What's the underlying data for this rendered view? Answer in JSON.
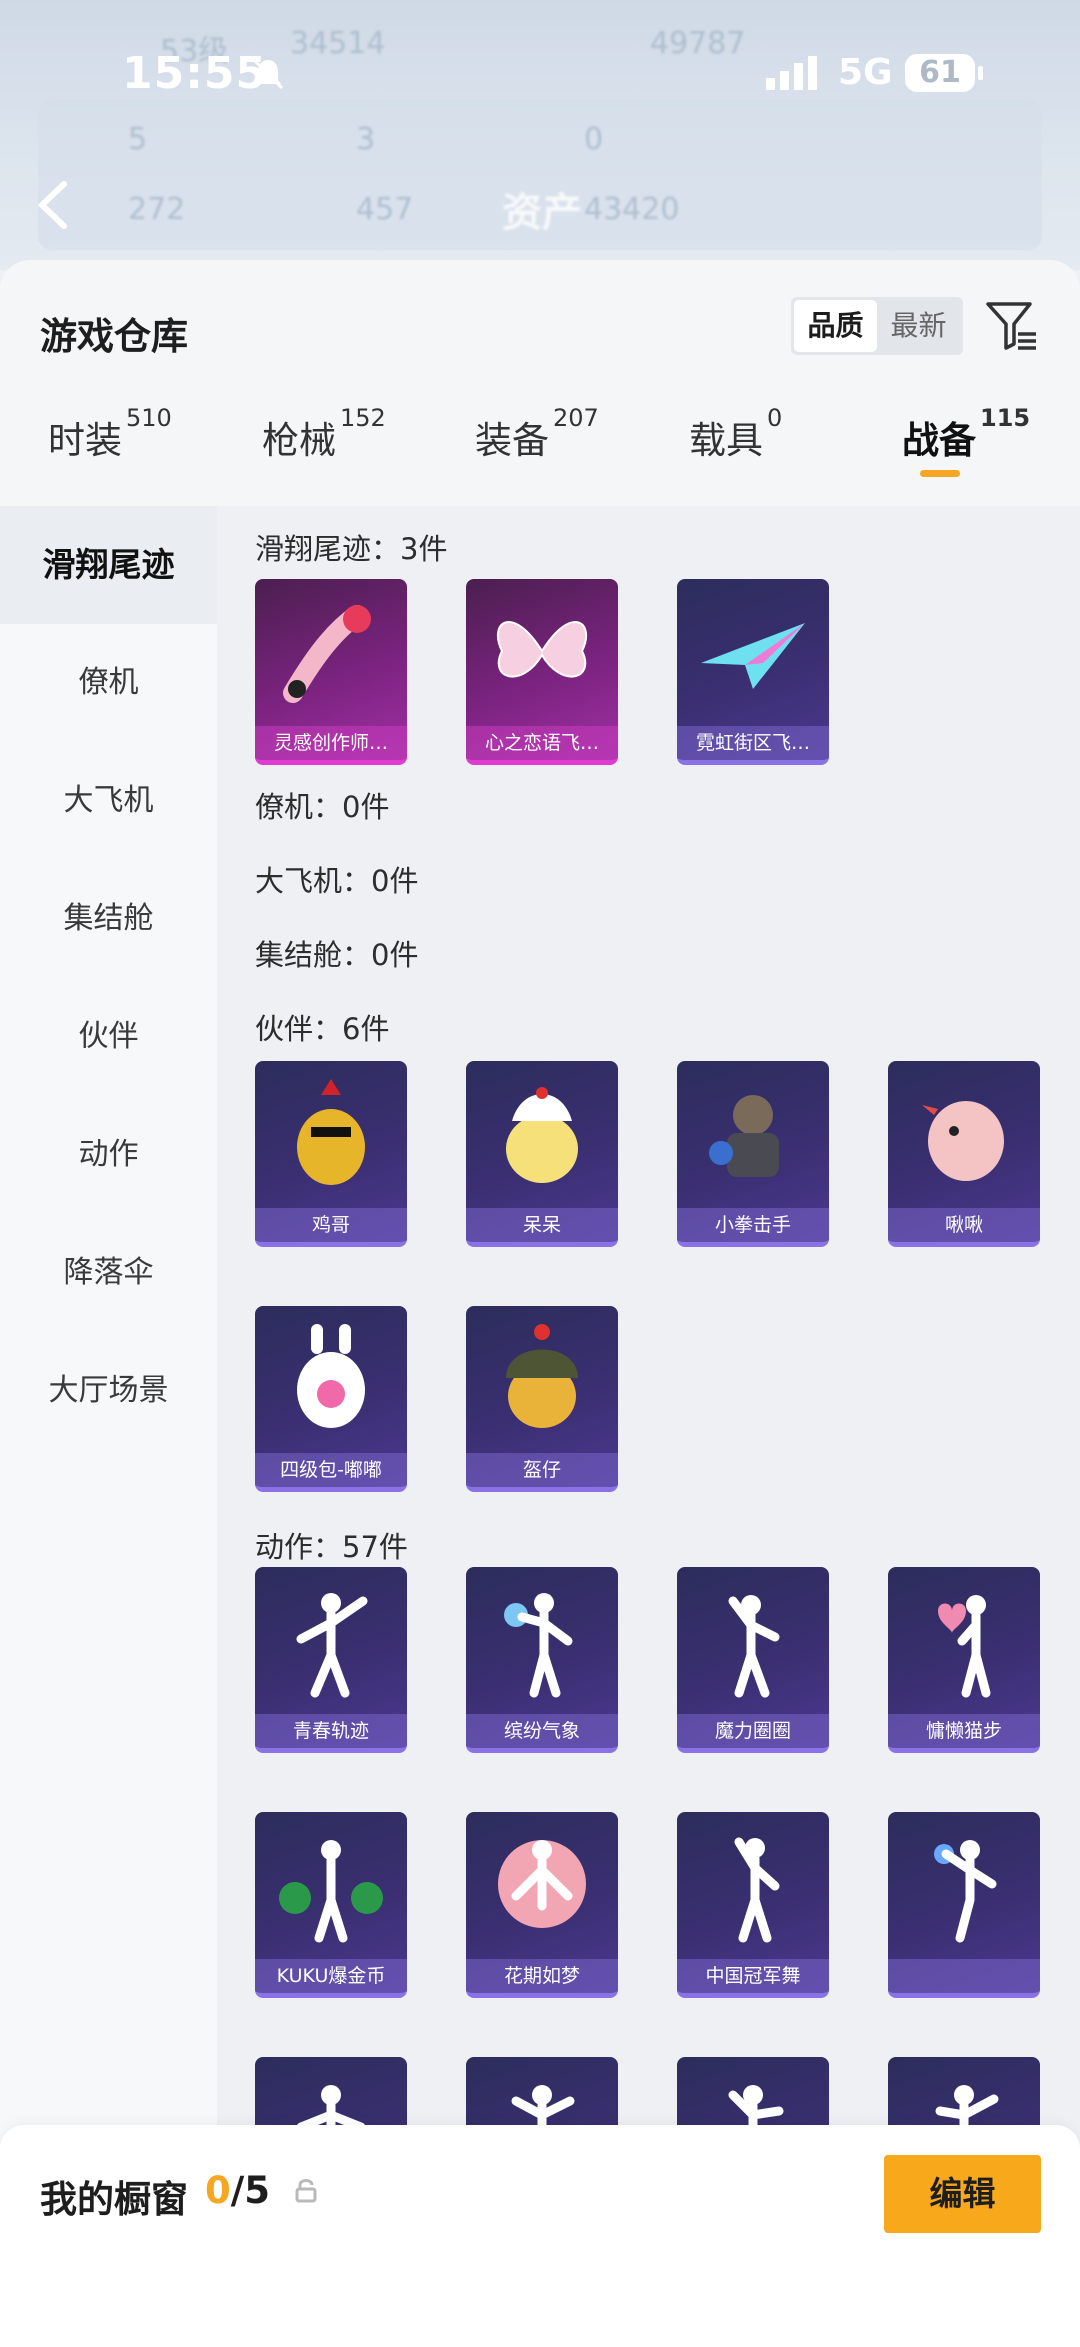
{
  "status": {
    "time": "15:55",
    "network": "5G",
    "battery": "61"
  },
  "header_bg": {
    "level": "53级",
    "coins": "34514",
    "score": "49787",
    "stats": [
      "5",
      "3",
      "0",
      "272",
      "457",
      "43420"
    ],
    "assets_label": "资产"
  },
  "warehouse": {
    "title": "游戏仓库",
    "sort_options": [
      "品质",
      "最新"
    ],
    "sort_active": "品质"
  },
  "tabs": [
    {
      "label": "时装",
      "count": "510"
    },
    {
      "label": "枪械",
      "count": "152"
    },
    {
      "label": "装备",
      "count": "207"
    },
    {
      "label": "载具",
      "count": "0"
    },
    {
      "label": "战备",
      "count": "115"
    }
  ],
  "categories": [
    "滑翔尾迹",
    "僚机",
    "大飞机",
    "集结舱",
    "伙伴",
    "动作",
    "降落伞",
    "大厅场景"
  ],
  "sections": {
    "trail": {
      "header": "滑翔尾迹：3件",
      "items": [
        "灵感创作师…",
        "心之恋语飞…",
        "霓虹街区飞…"
      ]
    },
    "wingman": {
      "header": "僚机：0件"
    },
    "plane": {
      "header": "大飞机：0件"
    },
    "pod": {
      "header": "集结舱：0件"
    },
    "partner": {
      "header": "伙伴：6件",
      "items": [
        "鸡哥",
        "呆呆",
        "小拳击手",
        "啾啾",
        "四级包-嘟嘟",
        "盔仔"
      ]
    },
    "emote": {
      "header": "动作：57件",
      "items": [
        "青春轨迹",
        "缤纷气象",
        "魔力圈圈",
        "慵懒猫步",
        "KUKU爆金币",
        "花期如梦",
        "中国冠军舞",
        ""
      ]
    }
  },
  "showcase": {
    "label": "我的橱窗",
    "current": "0",
    "total": "/5",
    "edit_label": "编辑"
  },
  "colors": {
    "accent": "#f5a623",
    "card_purple": "#3b2f72",
    "card_pink": "#a12fa4"
  }
}
